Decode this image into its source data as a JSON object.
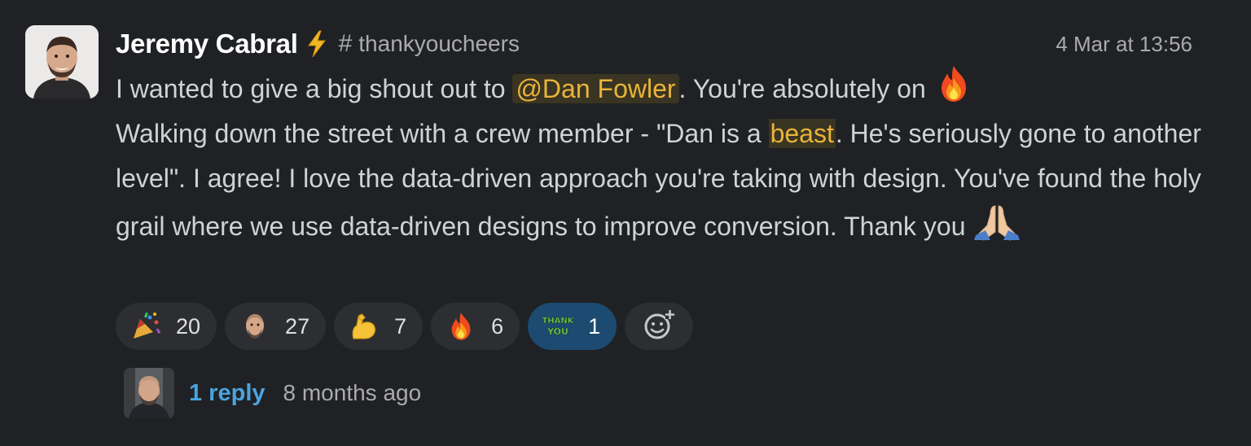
{
  "message": {
    "author": "Jeremy Cabral",
    "status_icon": "lightning-bolt-icon",
    "channel_hash": "#",
    "channel": "thankyoucheers",
    "timestamp": "4 Mar at 13:56",
    "line1_before": "I wanted to give a big shout out to ",
    "mention": "@Dan Fowler",
    "line1_after": ". You're absolutely on ",
    "body_part2": "Walking down the street with a crew member - \"Dan is a ",
    "highlight_word": "beast",
    "body_part3": ". He's seriously gone to another level\". I agree! I love the data-driven approach you're taking with design. You've found the holy grail where we use data-driven designs to improve conversion. Thank you ",
    "emoji_fire": "fire-emoji",
    "emoji_pray": "folded-hands-emoji"
  },
  "reactions": [
    {
      "emoji": "party-popper-emoji",
      "count": "20",
      "active": false
    },
    {
      "emoji": "custom-face-emoji",
      "count": "27",
      "active": false
    },
    {
      "emoji": "flexed-biceps-emoji",
      "count": "7",
      "active": false
    },
    {
      "emoji": "fire-emoji",
      "count": "6",
      "active": false
    },
    {
      "emoji": "thank-you-emoji",
      "count": "1",
      "active": true
    }
  ],
  "add_reaction_icon": "add-reaction-icon",
  "thread": {
    "reply_label": "1 reply",
    "reply_time": "8 months ago"
  },
  "colors": {
    "background": "#1f2124",
    "mention": "#e8b43a",
    "link": "#4aa3df",
    "active_reaction": "#1c4a70"
  }
}
